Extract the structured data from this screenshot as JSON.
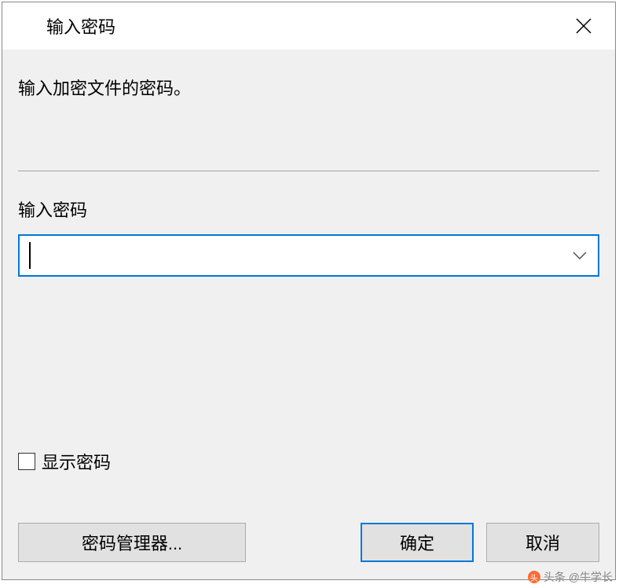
{
  "dialog": {
    "title": "输入密码",
    "instruction": "输入加密文件的密码。",
    "field_label": "输入密码",
    "password_value": "",
    "show_password_label": "显示密码",
    "show_password_checked": false
  },
  "buttons": {
    "password_manager": "密码管理器...",
    "ok": "确定",
    "cancel": "取消"
  },
  "watermark": {
    "prefix": "头条",
    "text": "@牛学长"
  }
}
